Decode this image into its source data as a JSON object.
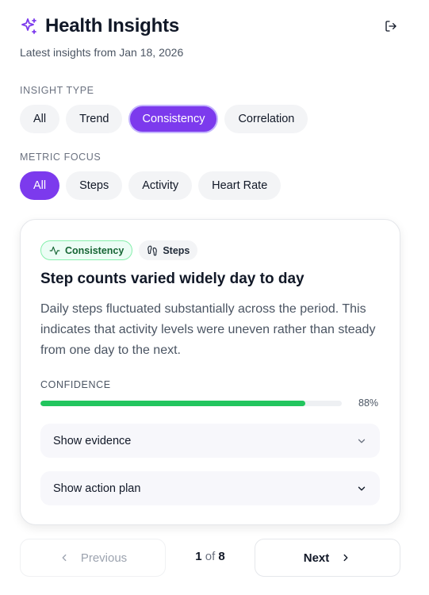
{
  "header": {
    "title": "Health Insights",
    "subtitle": "Latest insights from Jan 18, 2026",
    "accent_color": "#7c3aed"
  },
  "insight_type": {
    "label": "INSIGHT TYPE",
    "options": [
      "All",
      "Trend",
      "Consistency",
      "Correlation"
    ],
    "selected": "Consistency"
  },
  "metric_focus": {
    "label": "METRIC FOCUS",
    "options": [
      "All",
      "Steps",
      "Activity",
      "Heart Rate"
    ],
    "selected": "All"
  },
  "card": {
    "badges": [
      {
        "label": "Consistency",
        "icon": "activity-pulse-icon",
        "color": "#166534"
      },
      {
        "label": "Steps",
        "icon": "footprints-icon",
        "color": "#1f2937"
      }
    ],
    "title": "Step counts varied widely day to day",
    "description": "Daily steps fluctuated substantially across the period. This indicates that activity levels were uneven rather than steady from one day to the next.",
    "confidence_label": "CONFIDENCE",
    "confidence_value": 0.88,
    "confidence_text": "88%",
    "confidence_color": "#22c55e",
    "accordions": [
      "Show evidence",
      "Show action plan"
    ]
  },
  "pagination": {
    "previous_label": "Previous",
    "next_label": "Next",
    "current": "1",
    "of_text": "of",
    "total": "8"
  }
}
